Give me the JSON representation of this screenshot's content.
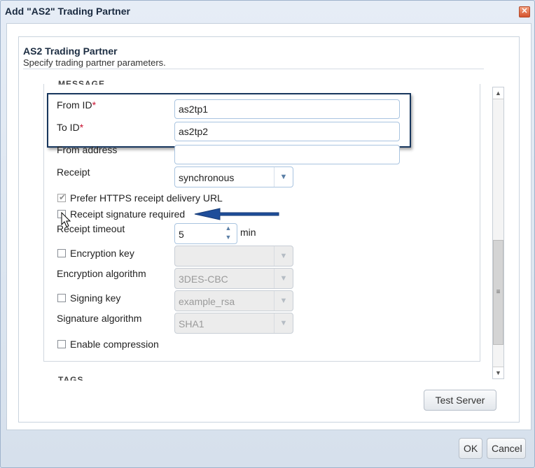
{
  "dialog": {
    "title": "Add \"AS2\" Trading Partner",
    "close_glyph": "✕"
  },
  "section": {
    "title": "AS2 Trading Partner",
    "subtitle": "Specify trading partner parameters."
  },
  "fieldset": {
    "message_legend": "MESSAGE",
    "tags_legend": "TAGS"
  },
  "form": {
    "from_id": {
      "label": "From ID",
      "required_mark": "*",
      "value": "as2tp1"
    },
    "to_id": {
      "label": "To ID",
      "required_mark": "*",
      "value": "as2tp2"
    },
    "from_address": {
      "label": "From address",
      "value": ""
    },
    "receipt": {
      "label": "Receipt",
      "value": "synchronous"
    },
    "prefer_https": {
      "label": "Prefer HTTPS receipt delivery URL",
      "checked": true
    },
    "receipt_signature": {
      "label": "Receipt signature required",
      "checked": false
    },
    "receipt_timeout": {
      "label": "Receipt timeout",
      "value": "5",
      "unit": "min"
    },
    "encryption_key": {
      "label": "Encryption key",
      "checked": false,
      "value": ""
    },
    "encryption_algorithm": {
      "label": "Encryption algorithm",
      "value": "3DES-CBC"
    },
    "signing_key": {
      "label": "Signing key",
      "checked": false,
      "value": "example_rsa"
    },
    "signature_algorithm": {
      "label": "Signature algorithm",
      "value": "SHA1"
    },
    "enable_compression": {
      "label": "Enable compression",
      "checked": false
    }
  },
  "buttons": {
    "test_server": "Test Server",
    "ok": "OK",
    "cancel": "Cancel"
  },
  "icons": {
    "dropdown": "chevron-down-icon",
    "spinner_up": "chevron-up-icon",
    "spinner_down": "chevron-down-icon",
    "scroll_up": "triangle-up-icon",
    "scroll_down": "triangle-down-icon",
    "checkmark": "checkmark-icon"
  },
  "colors": {
    "required": "#c8102e",
    "highlight_border": "#17365d",
    "annotation_arrow": "#1f4e9a"
  }
}
